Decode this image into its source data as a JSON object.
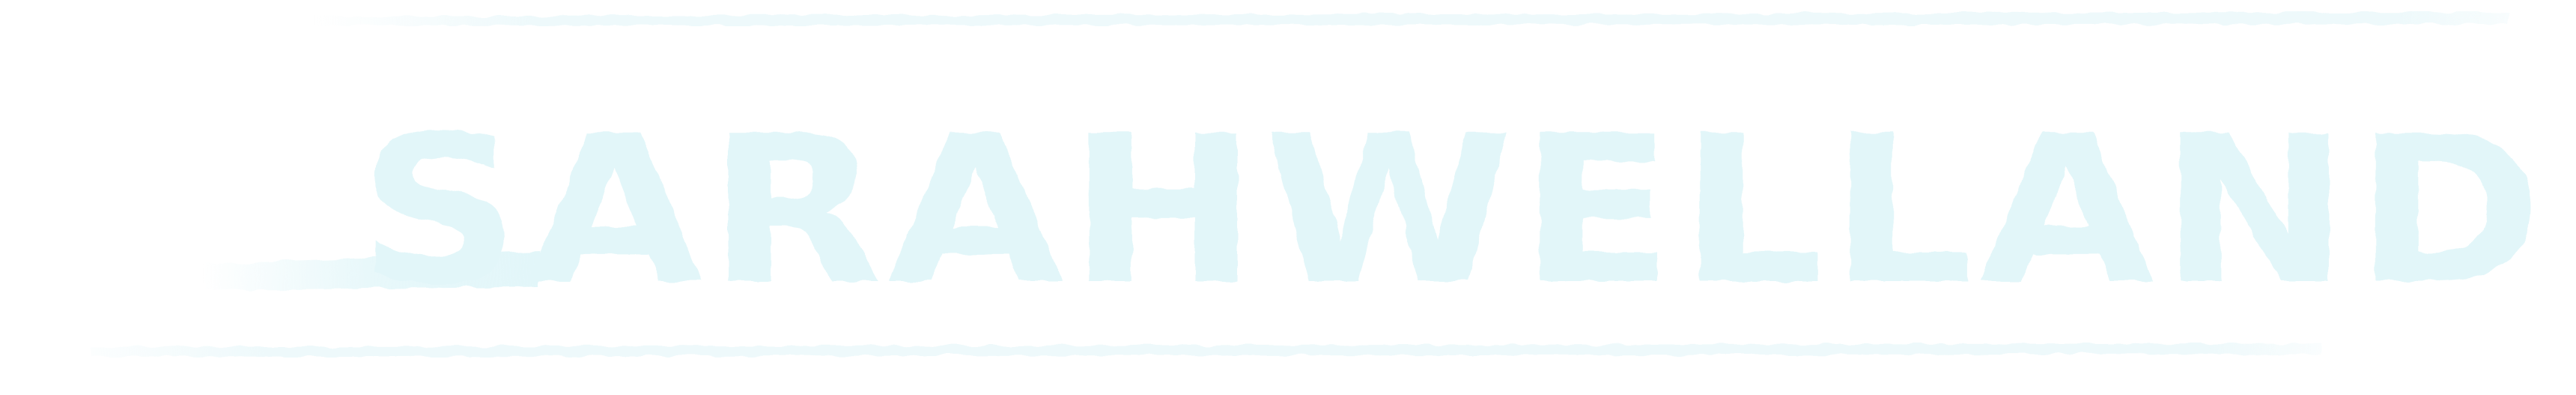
{
  "logo": {
    "text": "SARAHWELLAND",
    "color": "#e2f6f9",
    "stroke_color": "#eef9fb",
    "style": "brush-stroke wordmark"
  }
}
